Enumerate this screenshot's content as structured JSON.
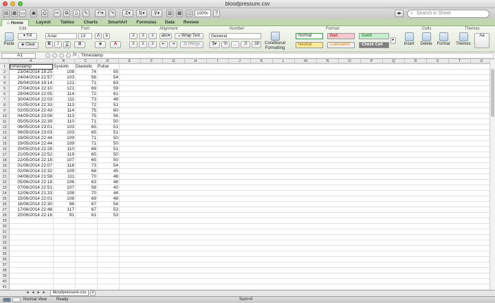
{
  "window": {
    "title": "bloodpressure.csv"
  },
  "toolbar": {
    "zoom": "100%",
    "search_placeholder": "Search in Sheet"
  },
  "tabs": [
    "Home",
    "Layout",
    "Tables",
    "Charts",
    "SmartArt",
    "Formulas",
    "Data",
    "Review"
  ],
  "ribbon": {
    "groups": {
      "edit": "Edit",
      "font": "Font",
      "alignment": "Alignment",
      "number": "Number",
      "format": "Format",
      "cells": "Cells",
      "themes": "Themes"
    },
    "paste": "Paste",
    "fill": "Fill",
    "clear": "Clear",
    "font_name": "Arial",
    "font_size": "13",
    "wrap_text": "Wrap Text",
    "merge": "Merge",
    "abc": "abc",
    "number_format": "General",
    "conditional_formatting_line1": "Conditional",
    "conditional_formatting_line2": "Formatting",
    "styles": {
      "normal": "Normal",
      "bad": "Bad",
      "good": "Good",
      "neutral": "Neutral",
      "calculation": "Calculation",
      "check_cell": "Check Cell"
    },
    "insert": "Insert",
    "delete": "Delete",
    "format": "Format",
    "themes": "Themes",
    "colors": {
      "normal_border": "#2e9a3e",
      "bad_bg": "#f7c7ce",
      "bad_fg": "#9c0006",
      "good_bg": "#c6efce",
      "good_fg": "#006100",
      "neutral_bg": "#ffeb9c",
      "neutral_fg": "#9c6500",
      "calc_fg": "#fa7d00",
      "check_bg": "#7f7f7f"
    }
  },
  "formula_bar": {
    "cell_ref": "A1",
    "fx": "fx",
    "content": "Timestamp"
  },
  "grid": {
    "columns": [
      "A",
      "B",
      "C",
      "D",
      "E",
      "F",
      "G",
      "H",
      "I",
      "J",
      "K",
      "L",
      "M",
      "N",
      "O",
      "P",
      "Q",
      "R",
      "S",
      "T",
      "U"
    ],
    "header": [
      "Timestamp",
      "Systolic",
      "Diastolic",
      "Pulse"
    ],
    "rows": [
      [
        "23/04/2014 18:25",
        "108",
        "74",
        "55"
      ],
      [
        "24/04/2014 22:57",
        "103",
        "56",
        "54"
      ],
      [
        "26/04/2014 18:14",
        "121",
        "71",
        "63"
      ],
      [
        "27/04/2014 22:10",
        "121",
        "69",
        "59"
      ],
      [
        "29/04/2014 22:05",
        "114",
        "72",
        "61"
      ],
      [
        "30/04/2014 22:03",
        "111",
        "73",
        "48"
      ],
      [
        "01/05/2014 22:33",
        "113",
        "72",
        "51"
      ],
      [
        "02/05/2014 22:43",
        "114",
        "75",
        "60"
      ],
      [
        "04/05/2014 23:08",
        "113",
        "75",
        "56"
      ],
      [
        "05/05/2014 22:39",
        "110",
        "71",
        "50"
      ],
      [
        "06/05/2014 23:01",
        "103",
        "65",
        "51"
      ],
      [
        "06/05/2014 23:03",
        "103",
        "65",
        "51"
      ],
      [
        "19/05/2014 22:44",
        "109",
        "71",
        "50"
      ],
      [
        "19/05/2014 22:44",
        "109",
        "71",
        "50"
      ],
      [
        "20/05/2014 22:28",
        "110",
        "68",
        "51"
      ],
      [
        "21/05/2014 22:52",
        "119",
        "65",
        "50"
      ],
      [
        "22/05/2014 22:18",
        "107",
        "65",
        "50"
      ],
      [
        "01/06/2014 22:07",
        "118",
        "73",
        "54"
      ],
      [
        "02/06/2014 22:32",
        "109",
        "68",
        "45"
      ],
      [
        "04/06/2014 21:58",
        "111",
        "70",
        "46"
      ],
      [
        "05/06/2014 22:18",
        "106",
        "63",
        "48"
      ],
      [
        "07/06/2014 22:51",
        "107",
        "58",
        "40"
      ],
      [
        "12/06/2014 21:33",
        "108",
        "70",
        "44"
      ],
      [
        "15/06/2014 22:01",
        "108",
        "69",
        "48"
      ],
      [
        "16/06/2014 22:30",
        "98",
        "67",
        "54"
      ],
      [
        "17/06/2014 22:46",
        "117",
        "67",
        "53"
      ],
      [
        "20/06/2014 22:16",
        "91",
        "61",
        "53"
      ]
    ],
    "total_rows": 42
  },
  "sheet_tab": "bloodpressure.csv",
  "status": {
    "view": "Normal View",
    "state": "Ready",
    "sum": "Sum=0"
  }
}
